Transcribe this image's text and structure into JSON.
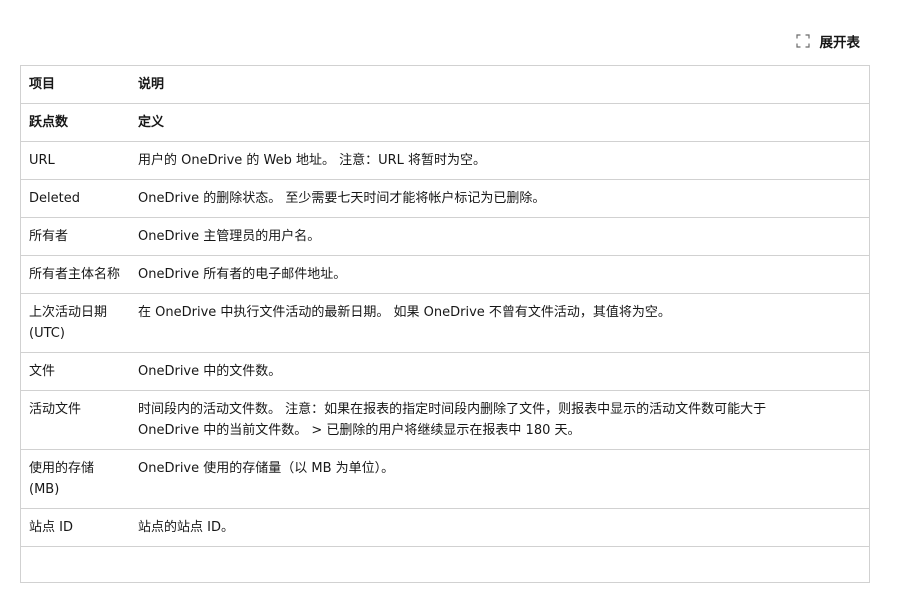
{
  "toolbar": {
    "expand_label": "展开表",
    "expand_icon": "expand-icon"
  },
  "table": {
    "headers": [
      "项目",
      "说明"
    ],
    "subheader": [
      "跃点数",
      "定义"
    ],
    "rows": [
      [
        "URL",
        "用户的 OneDrive 的 Web 地址。 注意：URL 将暂时为空。"
      ],
      [
        "Deleted",
        "OneDrive 的删除状态。 至少需要七天时间才能将帐户标记为已删除。"
      ],
      [
        "所有者",
        "OneDrive 主管理员的用户名。"
      ],
      [
        "所有者主体名称",
        "OneDrive 所有者的电子邮件地址。"
      ],
      [
        "上次活动日期 (UTC)",
        "在 OneDrive 中执行文件活动的最新日期。 如果 OneDrive 不曾有文件活动，其值将为空。"
      ],
      [
        "文件",
        "OneDrive 中的文件数。"
      ],
      [
        "活动文件",
        "时间段内的活动文件数。 注意：如果在报表的指定时间段内删除了文件，则报表中显示的活动文件数可能大于 OneDrive 中的当前文件数。 > 已删除的用户将继续显示在报表中 180 天。"
      ],
      [
        "使用的存储 (MB)",
        "OneDrive 使用的存储量（以 MB 为单位）。"
      ],
      [
        "站点 ID",
        "站点的站点 ID。"
      ]
    ]
  }
}
